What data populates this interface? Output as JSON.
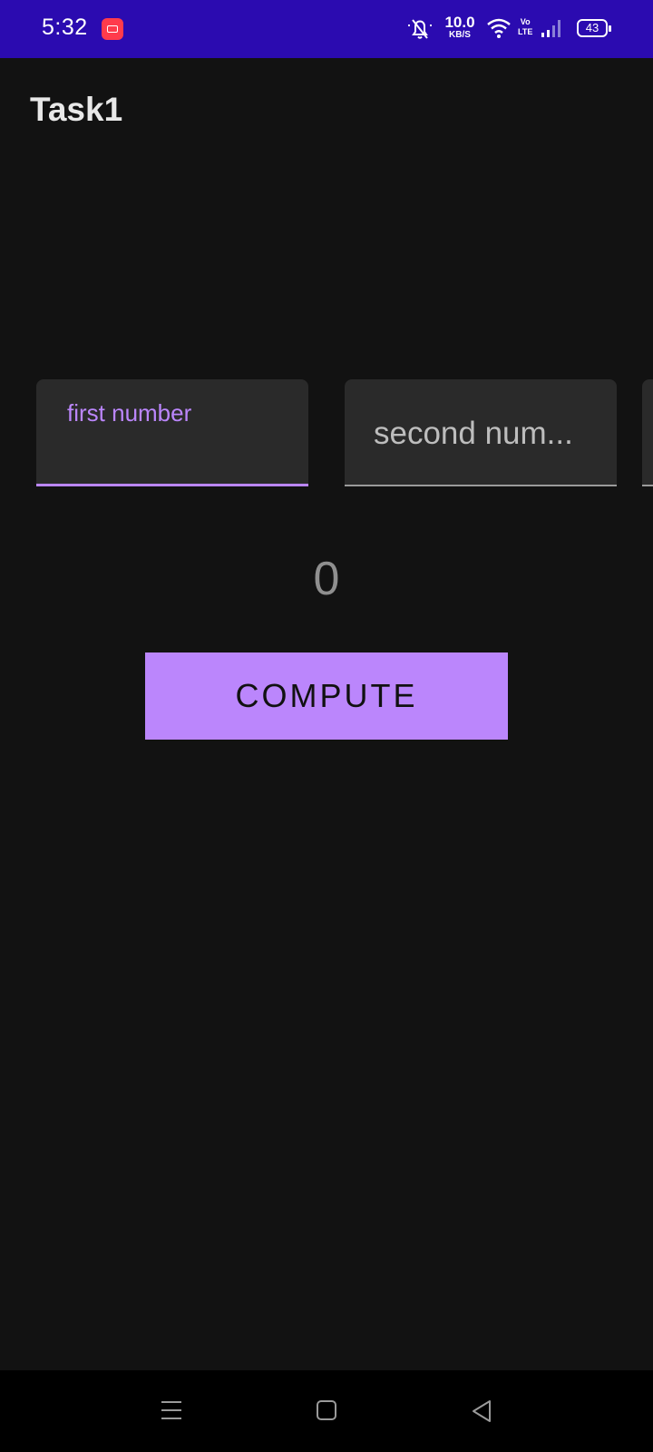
{
  "status_bar": {
    "time": "5:32",
    "speed_value": "10.0",
    "speed_unit": "KB/S",
    "network_top": "Vo",
    "network_bottom": "LTE",
    "battery": "43"
  },
  "app": {
    "title": "Task1"
  },
  "inputs": {
    "first": {
      "label": "first number",
      "value": ""
    },
    "second": {
      "placeholder": "second num..."
    }
  },
  "result": {
    "value": "0"
  },
  "compute_button": {
    "label": "COMPUTE"
  },
  "colors": {
    "status_bar": "#2b0bb0",
    "background": "#121212",
    "accent": "#bb86fc",
    "field_bg": "#2a2a2a",
    "nav_bar": "#000000"
  },
  "icons": {
    "recording": "screen-record-icon",
    "mute": "bell-off-icon",
    "wifi": "wifi-icon",
    "signal": "cell-signal-icon",
    "nav_menu": "menu-icon",
    "nav_home": "home-square-icon",
    "nav_back": "back-triangle-icon"
  }
}
